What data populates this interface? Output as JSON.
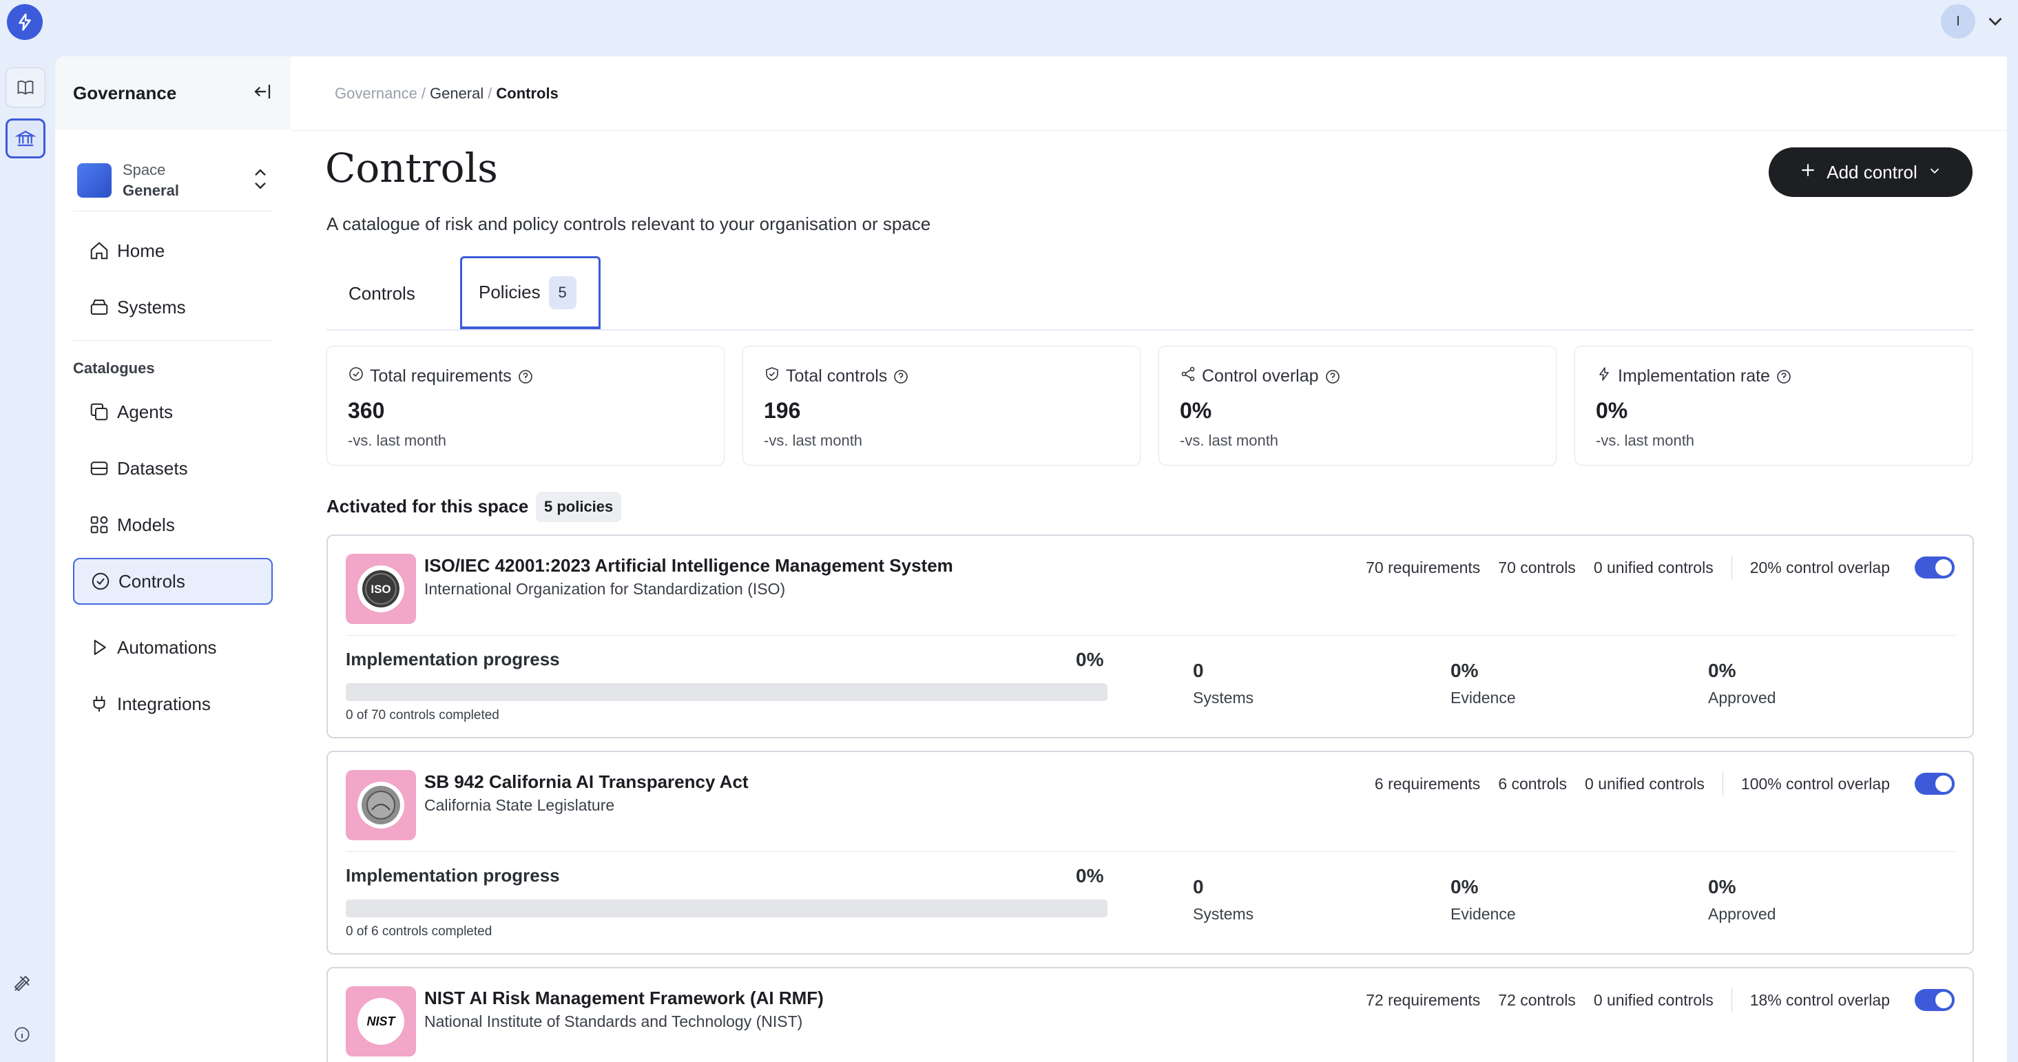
{
  "user": {
    "avatar_initial": "I"
  },
  "sidebar": {
    "title": "Governance",
    "space": {
      "label": "Space",
      "name": "General"
    },
    "nav_top": [
      {
        "label": "Home",
        "icon": "home-icon"
      },
      {
        "label": "Systems",
        "icon": "systems-icon"
      }
    ],
    "section_label": "Catalogues",
    "nav_catalogues": [
      {
        "label": "Agents",
        "icon": "agents-icon"
      },
      {
        "label": "Datasets",
        "icon": "datasets-icon"
      },
      {
        "label": "Models",
        "icon": "models-icon"
      },
      {
        "label": "Controls",
        "icon": "controls-icon",
        "active": true
      }
    ],
    "nav_bottom": [
      {
        "label": "Automations",
        "icon": "play-icon"
      },
      {
        "label": "Integrations",
        "icon": "plug-icon"
      }
    ]
  },
  "breadcrumb": {
    "root": "Governance",
    "middle": "General",
    "current": "Controls",
    "sep": "/"
  },
  "header": {
    "title": "Controls",
    "subtitle": "A catalogue of risk and policy controls relevant to your organisation or space",
    "add_button": "Add control"
  },
  "tabs": [
    {
      "label": "Controls"
    },
    {
      "label": "Policies",
      "count": "5",
      "active": true
    }
  ],
  "stats": [
    {
      "label": "Total requirements",
      "value": "360",
      "sub": "-vs. last month",
      "icon": "check-circle-icon"
    },
    {
      "label": "Total controls",
      "value": "196",
      "sub": "-vs. last month",
      "icon": "shield-check-icon"
    },
    {
      "label": "Control overlap",
      "value": "0%",
      "sub": "-vs. last month",
      "icon": "share-icon"
    },
    {
      "label": "Implementation rate",
      "value": "0%",
      "sub": "-vs. last month",
      "icon": "bolt-icon"
    }
  ],
  "activated": {
    "title": "Activated for this space",
    "badge": "5 policies"
  },
  "policies": [
    {
      "name": "ISO/IEC 42001:2023 Artificial Intelligence Management System",
      "org": "International Organization for Standardization (ISO)",
      "logo_text": "ISO",
      "requirements": "70 requirements",
      "controls": "70 controls",
      "unified": "0 unified controls",
      "overlap": "20% control overlap",
      "enabled": true,
      "progress_label": "Implementation progress",
      "progress_pct": "0%",
      "progress_value": 0,
      "progress_sub": "0 of 70 controls completed",
      "systems": "0",
      "systems_label": "Systems",
      "evidence": "0%",
      "evidence_label": "Evidence",
      "approved": "0%",
      "approved_label": "Approved"
    },
    {
      "name": "SB 942 California AI Transparency Act",
      "org": "California State Legislature",
      "logo_text": "",
      "requirements": "6 requirements",
      "controls": "6 controls",
      "unified": "0 unified controls",
      "overlap": "100% control overlap",
      "enabled": true,
      "progress_label": "Implementation progress",
      "progress_pct": "0%",
      "progress_value": 0,
      "progress_sub": "0 of 6 controls completed",
      "systems": "0",
      "systems_label": "Systems",
      "evidence": "0%",
      "evidence_label": "Evidence",
      "approved": "0%",
      "approved_label": "Approved"
    },
    {
      "name": "NIST AI Risk Management Framework (AI RMF)",
      "org": "National Institute of Standards and Technology (NIST)",
      "logo_text": "NIST",
      "requirements": "72 requirements",
      "controls": "72 controls",
      "unified": "0 unified controls",
      "overlap": "18% control overlap",
      "enabled": true
    }
  ],
  "colors": {
    "accent": "#3d5bd9",
    "logo_pink": "#f2a6c8",
    "dark_button": "#1d1f23"
  }
}
